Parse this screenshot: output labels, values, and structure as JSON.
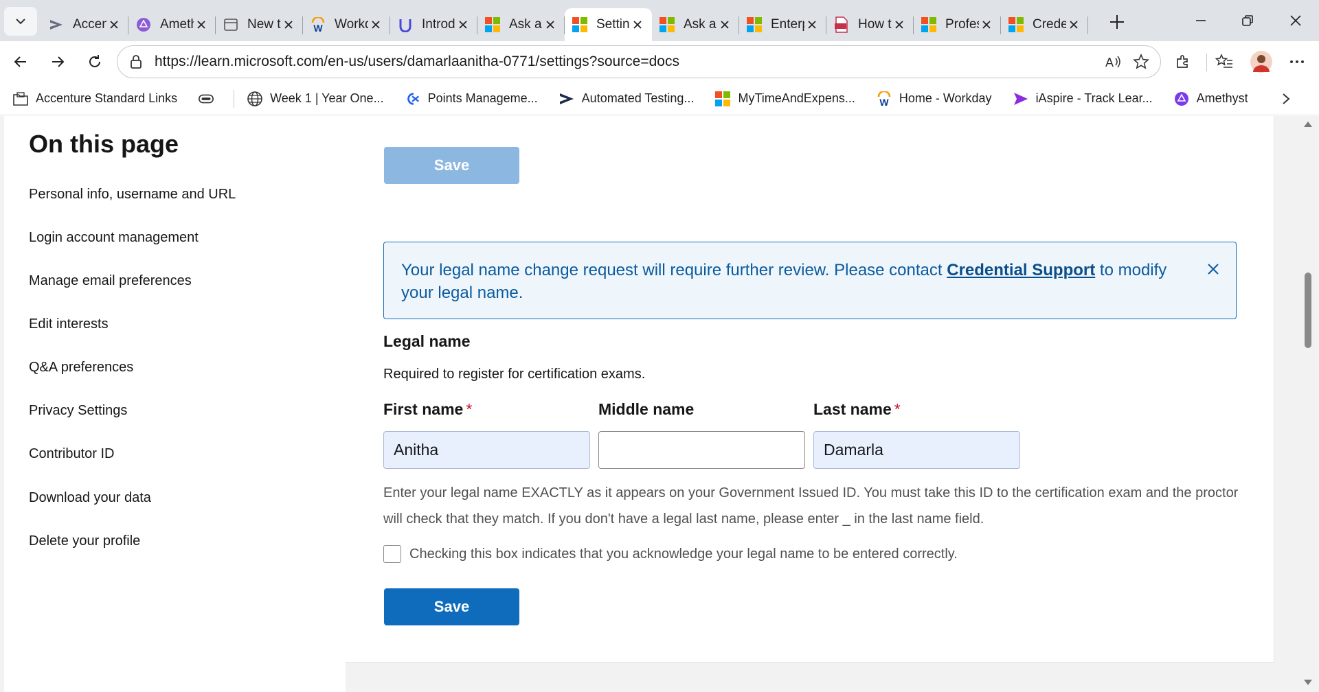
{
  "browser": {
    "tabs": [
      {
        "title": "Accenture",
        "icon": "accenture-icon"
      },
      {
        "title": "Amethyst",
        "icon": "amethyst-icon"
      },
      {
        "title": "New tab",
        "icon": "newtab-icon"
      },
      {
        "title": "Workday",
        "icon": "workday-icon"
      },
      {
        "title": "Introduction",
        "icon": "unity-icon"
      },
      {
        "title": "Ask a question",
        "icon": "microsoft-icon"
      },
      {
        "title": "Settings",
        "icon": "microsoft-icon",
        "active": true
      },
      {
        "title": "Ask a question",
        "icon": "microsoft-icon"
      },
      {
        "title": "Enterprise",
        "icon": "microsoft-icon"
      },
      {
        "title": "How to",
        "icon": "pdf-icon"
      },
      {
        "title": "Professional",
        "icon": "microsoft-icon"
      },
      {
        "title": "Credentials",
        "icon": "microsoft-icon"
      }
    ],
    "url": "https://learn.microsoft.com/en-us/users/damarlaanitha-0771/settings?source=docs",
    "bookmarks": [
      {
        "label": "Accenture Standard Links",
        "icon": "folder-icon"
      },
      {
        "label": "Week 1 | Year One...",
        "icon": "globe-icon"
      },
      {
        "label": "Points Manageme...",
        "icon": "points-icon"
      },
      {
        "label": "Automated Testing...",
        "icon": "accenture-icon"
      },
      {
        "label": "MyTimeAndExpens...",
        "icon": "microsoft-icon"
      },
      {
        "label": "Home - Workday",
        "icon": "workday-icon"
      },
      {
        "label": "iAspire - Track Lear...",
        "icon": "iaspire-icon"
      },
      {
        "label": "Amethyst",
        "icon": "amethyst-icon"
      }
    ]
  },
  "sidebar": {
    "title": "On this page",
    "items": [
      "Personal info, username and URL",
      "Login account management",
      "Manage email preferences",
      "Edit interests",
      "Q&A preferences",
      "Privacy Settings",
      "Contributor ID",
      "Download your data",
      "Delete your profile"
    ]
  },
  "main": {
    "save_top_label": "Save",
    "alert": {
      "text_before": "Your legal name change request will require further review. Please contact ",
      "link": "Credential Support",
      "text_after": " to modify your legal name."
    },
    "legal_heading": "Legal name",
    "legal_desc": "Required to register for certification exams.",
    "fields": {
      "first_label": "First name",
      "first_value": "Anitha",
      "middle_label": "Middle name",
      "middle_value": "",
      "last_label": "Last name",
      "last_value": "Damarla",
      "required_mark": "*"
    },
    "help_text": "Enter your legal name EXACTLY as it appears on your Government Issued ID. You must take this ID to the certification exam and the proctor will check that they match. If you don't have a legal last name, please enter _ in the last name field.",
    "ack_label": "Checking this box indicates that you acknowledge your legal name to be entered correctly.",
    "save_bottom_label": "Save"
  },
  "colors": {
    "primary": "#0f6cbd",
    "primary_disabled": "#8cb7e0",
    "alert_bg": "#eef6fc",
    "required": "#c50f1f"
  }
}
